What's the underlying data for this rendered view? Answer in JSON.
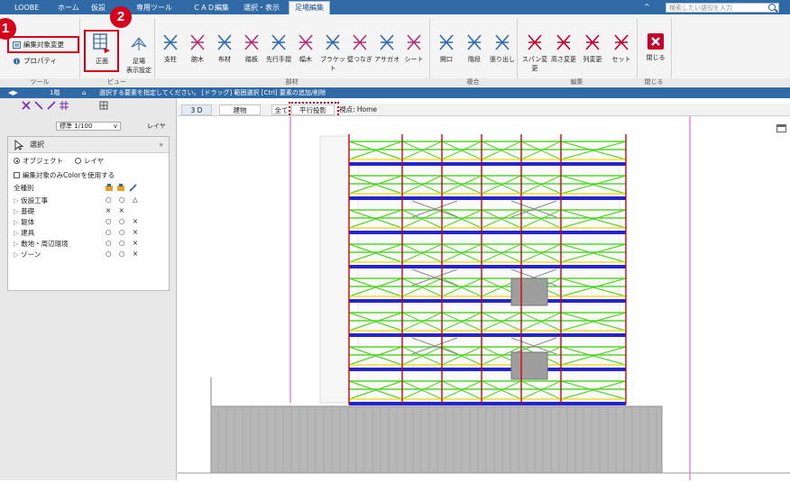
{
  "ribbon_tabs": [
    {
      "label": "LOOBE",
      "active": false
    },
    {
      "label": "ホーム",
      "active": false
    },
    {
      "label": "仮設",
      "active": false
    },
    {
      "label": "専用ツール",
      "active": false
    },
    {
      "label": "ＣＡＤ編集",
      "active": false
    },
    {
      "label": "選択・表示",
      "active": false
    },
    {
      "label": "足場編集",
      "active": true
    }
  ],
  "search": {
    "placeholder": "検索したい語句を入力"
  },
  "tools_group": {
    "edit_target_label": "編集対象変更",
    "property_label": "プロパティ",
    "group_label": "ツール"
  },
  "view_group": {
    "front_label": "正面",
    "scaffold_display_label_1": "足場",
    "scaffold_display_label_2": "表示設定",
    "group_label": "ビュー"
  },
  "parts_group": {
    "items": [
      "支柱",
      "腕木",
      "布材",
      "踏板",
      "先行手摺",
      "幅木",
      "ブラケット",
      "壁つなぎ",
      "アサガオ",
      "シート"
    ],
    "group_label": "部材"
  },
  "compound_group": {
    "items": [
      "開口",
      "階段",
      "張り出し"
    ],
    "group_label": "複合"
  },
  "edit_group": {
    "items": [
      "スパン変更",
      "高さ変更",
      "列変更",
      "セット"
    ],
    "group_label": "編集"
  },
  "close_group": {
    "close_label": "閉じる",
    "group_label": "閉じる"
  },
  "status_bar": {
    "floor": "1階",
    "message": "選択する要素を指定してください。 [ドラッグ] 範囲選択 [Ctrl] 要素の追加/削除"
  },
  "left_panel": {
    "scale": "標準 1/100",
    "layer_label": "レイヤ",
    "select_title": "選択",
    "radio_object": "オブジェクト",
    "radio_layer": "レイヤ",
    "use_color_label": "編集対象のみColorを使用する",
    "all_types": "全種別",
    "rows": [
      {
        "label": "仮設工事",
        "marks": "○ ○ △"
      },
      {
        "label": "基礎",
        "marks": "× ×"
      },
      {
        "label": "躯体",
        "marks": "○ ○ ×"
      },
      {
        "label": "建具",
        "marks": "○ ○ ×"
      },
      {
        "label": "敷地・周辺環境",
        "marks": "○ ○ ×"
      },
      {
        "label": "ゾーン",
        "marks": "○ ○ ×"
      }
    ]
  },
  "canvas_tabs": {
    "tab_3d": "3 D",
    "tab_building": "建物",
    "tab_all": "全て",
    "tab_parallel": "平行投影",
    "viewpoint": "視点: Home"
  },
  "badges": {
    "step1": "1",
    "step2": "2"
  },
  "colors": {
    "accent_red": "#d7001b",
    "scaffold_red": "#d40000",
    "scaffold_blue": "#2323d0",
    "scaffold_green": "#55d62a",
    "scaffold_yellow": "#f0e020",
    "guide_magenta": "#e24ad6"
  }
}
